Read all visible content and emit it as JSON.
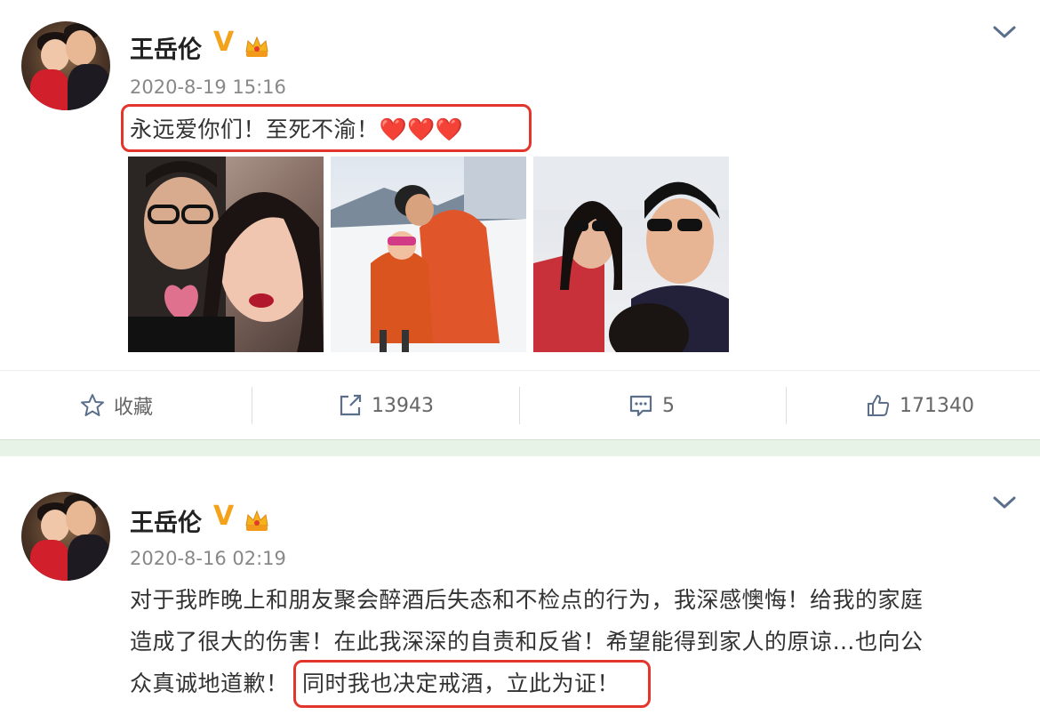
{
  "posts": [
    {
      "author": "王岳伦",
      "time": "2020-8-19 15:16",
      "text_lines": [
        "永远爱你们！至死不渝！"
      ],
      "emoji": "❤️❤️❤️",
      "photos": [
        "photo-couple-selfie",
        "photo-ski-slope",
        "photo-family-boat"
      ],
      "actions": {
        "favorite": "收藏",
        "repost": "13943",
        "comment": "5",
        "like": "171340"
      }
    },
    {
      "author": "王岳伦",
      "time": "2020-8-16 02:19",
      "text_lines": [
        "对于我昨晚上和朋友聚会醉酒后失态和不检点的行为，我深感懊悔！给我的家庭",
        "造成了很大的伤害！在此我深深的自责和反省！希望能得到家人的原谅…也向公",
        "众真诚地道歉！",
        "同时我也决定戒酒，立此为证！"
      ]
    }
  ],
  "icons": {
    "verified": "V",
    "crown": "crown-icon",
    "menu": "chevron-down-icon",
    "favorite": "star-icon",
    "repost": "share-icon",
    "comment": "comment-icon",
    "like": "thumbs-up-icon"
  },
  "colors": {
    "highlight_box": "#e3352b",
    "verified_badge": "#f4a21a",
    "divider": "#e8f3e8"
  }
}
